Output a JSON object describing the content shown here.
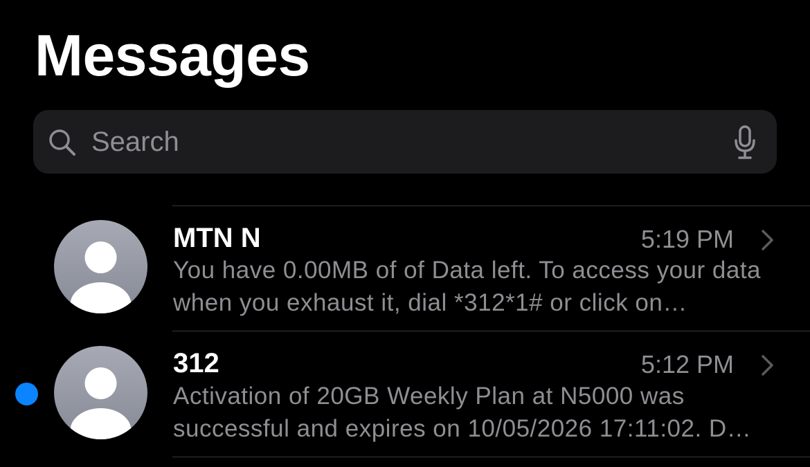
{
  "page_title": "Messages",
  "search": {
    "placeholder": "Search",
    "icon": "magnifying-glass",
    "voice_icon": "microphone"
  },
  "colors": {
    "background": "#000000",
    "search_fill": "#1c1c1e",
    "secondary_text": "#8e8e93",
    "unread_dot": "#0a84ff",
    "divider": "#38383a",
    "avatar": "#9a9da8"
  },
  "conversations": [
    {
      "sender": "MTN N",
      "time": "5:19 PM",
      "preview": "You have 0.00MB of of Data left. To access your data when you exhaust it, dial *312*1# or click on…",
      "unread": false,
      "avatar_icon": "person-silhouette",
      "chevron_icon": "chevron-right"
    },
    {
      "sender": "312",
      "time": "5:12 PM",
      "preview": "Activation of 20GB Weekly Plan at N5000 was successful and expires on 10/05/2026 17:11:02. D…",
      "unread": true,
      "avatar_icon": "person-silhouette",
      "chevron_icon": "chevron-right"
    }
  ]
}
